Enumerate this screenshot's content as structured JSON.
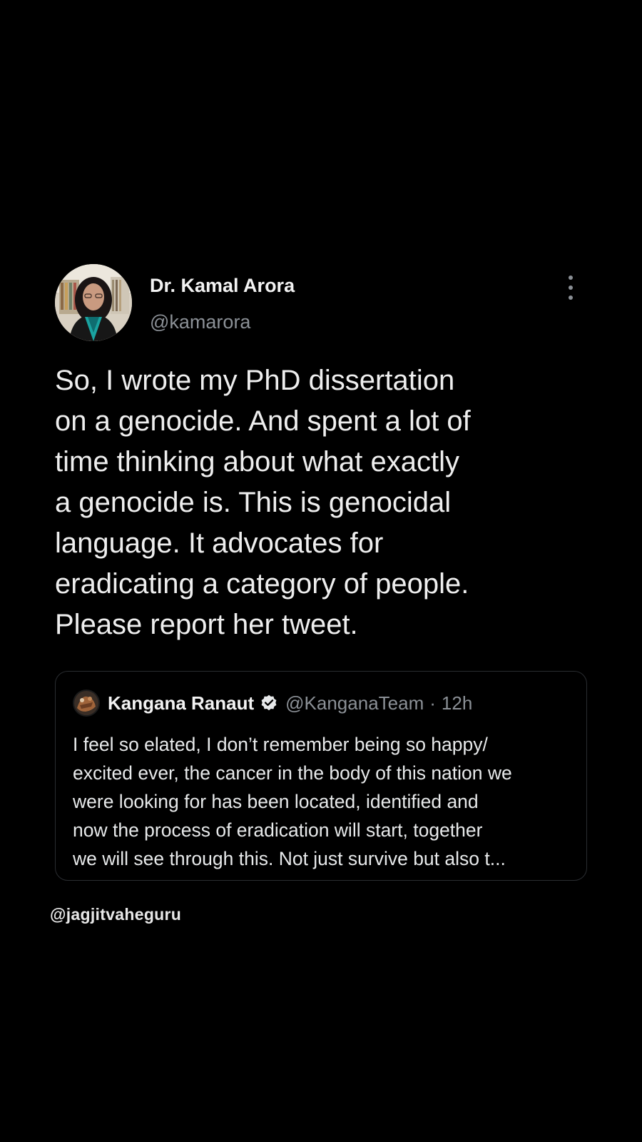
{
  "tweet": {
    "author": {
      "name": "Dr. Kamal Arora",
      "handle": "@kamarora",
      "avatar_icon": "profile-photo"
    },
    "more_icon": "more-options-icon",
    "text": "So, I wrote my PhD dissertation\non a genocide. And spent a lot of\ntime thinking about what exactly\na genocide is. This is genocidal\nlanguage. It advocates for\neradicating a category of people.\nPlease report her tweet.",
    "quoted_tweet": {
      "author_name": "Kangana Ranaut",
      "verified_icon": "verified-badge-icon",
      "handle": "@KanganaTeam",
      "separator": "·",
      "time": "12h",
      "text": "I feel so elated, I don’t remember being so happy/\nexcited ever, the cancer in the body of this nation we\nwere looking for has been located, identified and\nnow the process of eradication will start, together\nwe will see through this. Not just survive but also t..."
    }
  },
  "watermark": "@jagjitvaheguru",
  "colors": {
    "background": "#000000",
    "primary_text": "#eeeeee",
    "secondary_text": "#8b9096",
    "card_border": "#2a2d31"
  }
}
